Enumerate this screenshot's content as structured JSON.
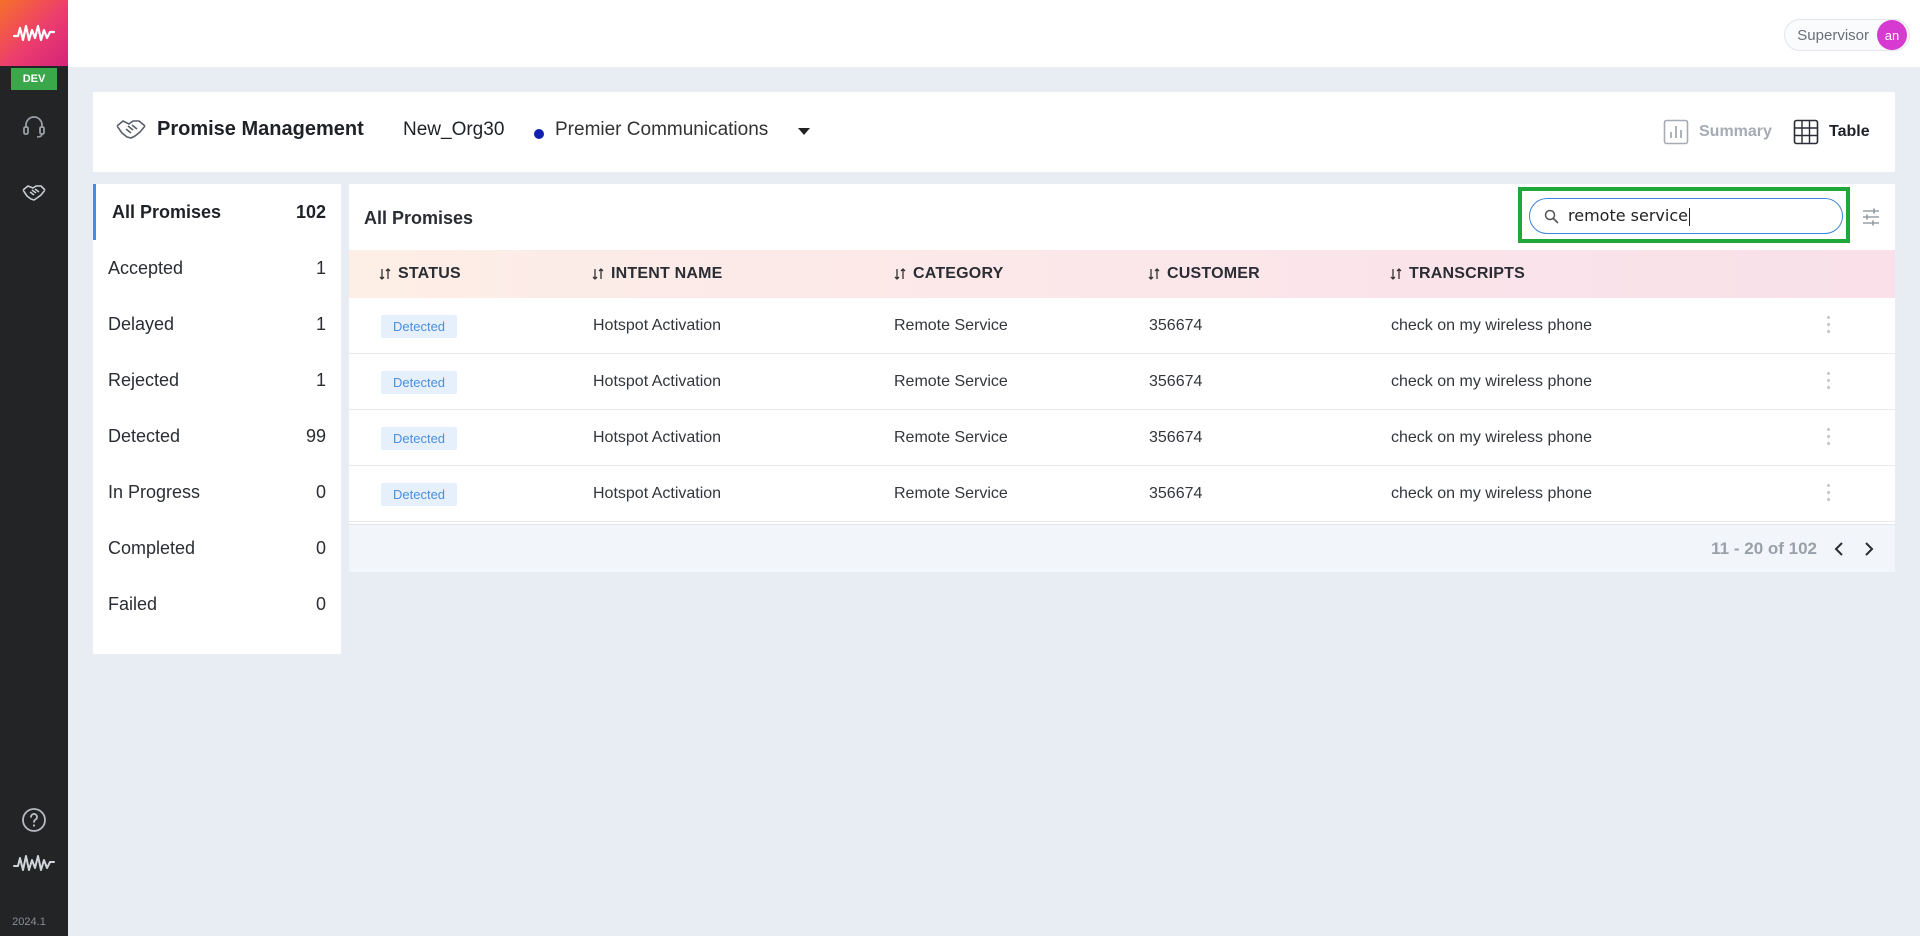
{
  "rail": {
    "env_badge": "DEV",
    "version": "2024.1",
    "icons": [
      "app-logo-icon",
      "headset-icon",
      "handshake-icon",
      "help-icon",
      "waveform-icon"
    ]
  },
  "topbar": {
    "role": "Supervisor",
    "avatar_initials": "an"
  },
  "header": {
    "title": "Promise Management",
    "org": "New_Org30",
    "company": "Premier Communications",
    "company_dot_color": "#1020b0",
    "views": {
      "summary": "Summary",
      "table": "Table",
      "active": "Table"
    }
  },
  "filters": [
    {
      "label": "All Promises",
      "count": "102",
      "active": true
    },
    {
      "label": "Accepted",
      "count": "1"
    },
    {
      "label": "Delayed",
      "count": "1"
    },
    {
      "label": "Rejected",
      "count": "1"
    },
    {
      "label": "Detected",
      "count": "99"
    },
    {
      "label": "In Progress",
      "count": "0"
    },
    {
      "label": "Completed",
      "count": "0"
    },
    {
      "label": "Failed",
      "count": "0"
    }
  ],
  "table": {
    "title": "All Promises",
    "search": {
      "value": "remote service",
      "placeholder": ""
    },
    "columns": [
      "STATUS",
      "INTENT NAME",
      "CATEGORY",
      "CUSTOMER",
      "TRANSCRIPTS"
    ],
    "rows": [
      {
        "status": "Detected",
        "intent": "Hotspot Activation",
        "category": "Remote Service",
        "customer": "356674",
        "transcript": "check on my wireless phone"
      },
      {
        "status": "Detected",
        "intent": "Hotspot Activation",
        "category": "Remote Service",
        "customer": "356674",
        "transcript": "check on my wireless phone"
      },
      {
        "status": "Detected",
        "intent": "Hotspot Activation",
        "category": "Remote Service",
        "customer": "356674",
        "transcript": "check on my wireless phone"
      },
      {
        "status": "Detected",
        "intent": "Hotspot Activation",
        "category": "Remote Service",
        "customer": "356674",
        "transcript": "check on my wireless phone"
      }
    ],
    "pagination": "11 - 20 of 102"
  },
  "colors": {
    "accent": "#3b8ff0",
    "highlight": "#1ea83a",
    "badge_bg": "#e6f0fc",
    "badge_text": "#4a8fe0"
  }
}
